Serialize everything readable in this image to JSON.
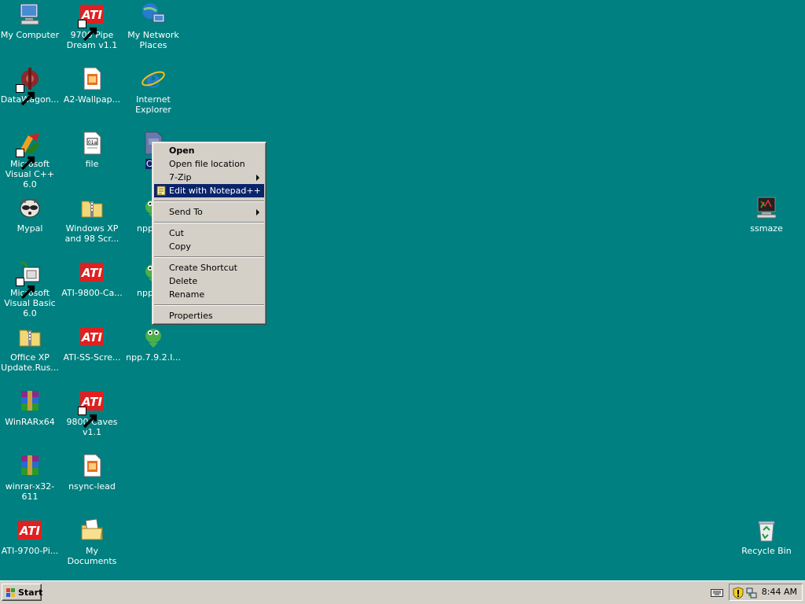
{
  "desktop": {
    "background": "#008080",
    "icons": {
      "my_computer": "My Computer",
      "pipe_dream": "9700 Pipe Dream v1.1",
      "network_places": "My Network Places",
      "datawagon": "DataWagon...",
      "a2_wallpaper": "A2-Wallpap...",
      "internet_explorer": "Internet Explorer",
      "msvc": "Microsoft Visual C++ 6.0",
      "file": "file",
      "selected_c": "C...",
      "mypal": "Mypal",
      "winxp_98": "Windows XP and 98 Scr...",
      "npp8_a": "npp.8...",
      "msvb": "Microsoft Visual Basic 6.0",
      "ati9800ca": "ATI-9800-Ca...",
      "npp8_b": "npp.8...",
      "officexp": "Office XP Update.Rus...",
      "atiss": "ATI-SS-Scre...",
      "npp792": "npp.7.9.2.I...",
      "winrarx64": "WinRARx64",
      "caves": "9800 Caves v1.1",
      "winrar32": "winrar-x32-611",
      "nsync": "nsync-lead",
      "ati9700pi": "ATI-9700-Pi...",
      "my_documents": "My Documents",
      "ssmaze": "ssmaze",
      "recycle_bin": "Recycle Bin"
    }
  },
  "context_menu": {
    "open": "Open",
    "open_location": "Open file location",
    "seven_zip": "7-Zip",
    "edit_npp": "Edit with Notepad++",
    "send_to": "Send To",
    "cut": "Cut",
    "copy": "Copy",
    "create_shortcut": "Create Shortcut",
    "delete": "Delete",
    "rename": "Rename",
    "properties": "Properties",
    "highlight_color": "#0a246a"
  },
  "taskbar": {
    "start_label": "Start",
    "clock": "8:44 AM"
  }
}
